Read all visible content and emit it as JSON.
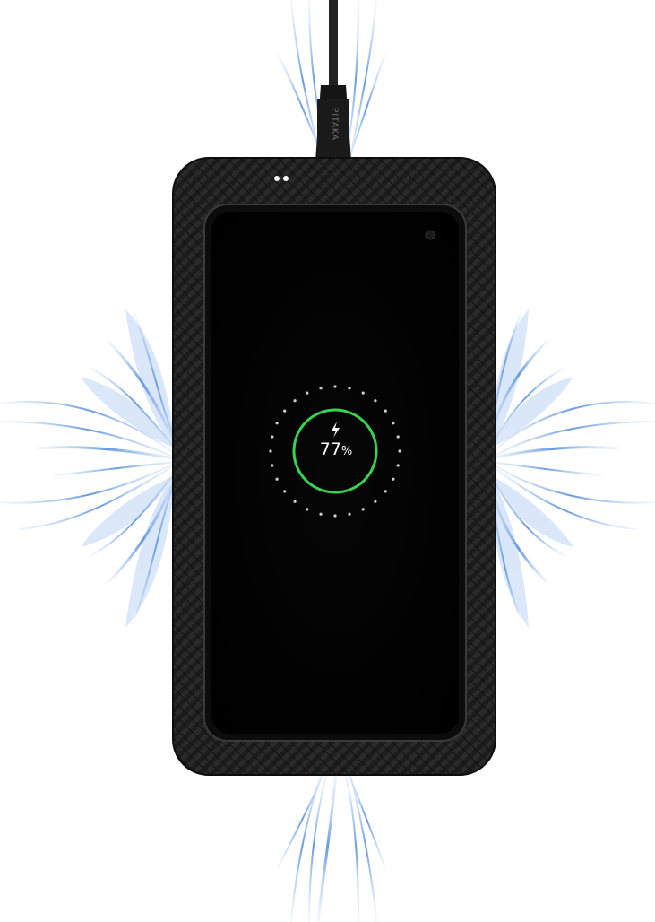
{
  "charging": {
    "percent": 77,
    "percent_value": "77",
    "percent_symbol": "%",
    "icon": "lightning-bolt-icon",
    "ring_color": "#39d353"
  },
  "cable": {
    "brand_text": "PITAKA"
  },
  "colors": {
    "pad": "#1a1a1a",
    "screen": "#000000",
    "waves": "#3a7bd5"
  }
}
